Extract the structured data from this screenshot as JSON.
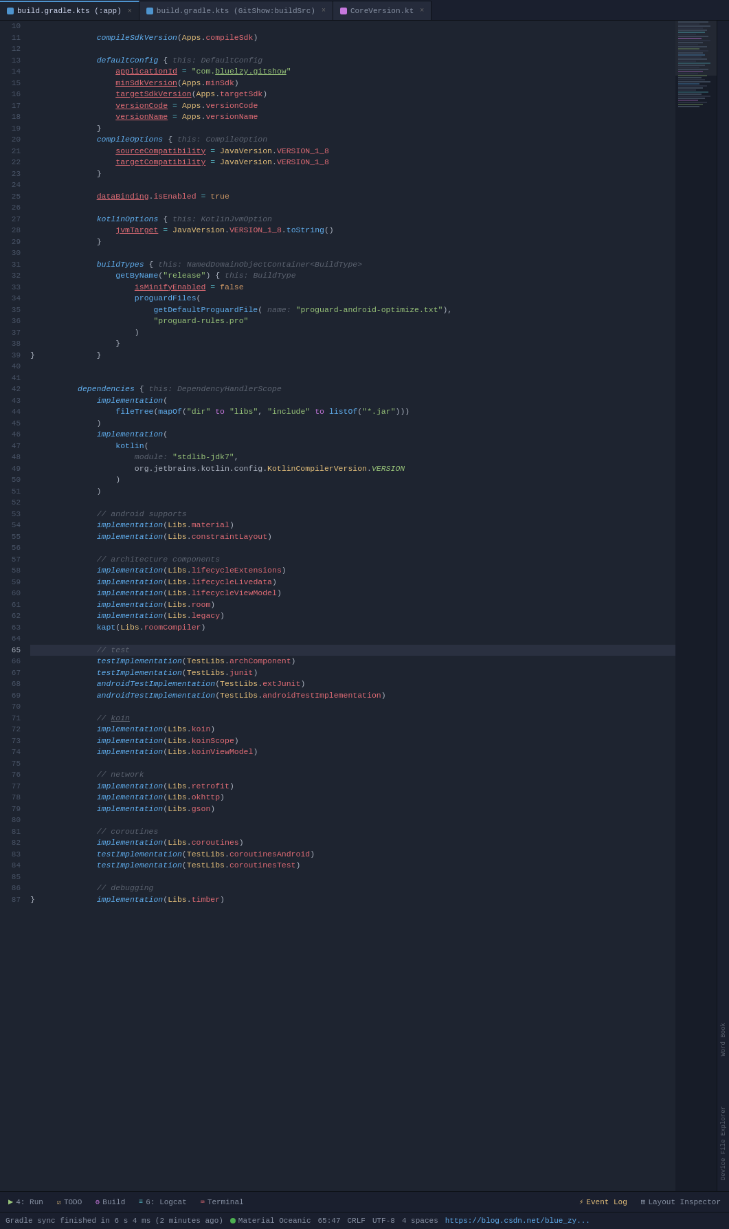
{
  "tabs": [
    {
      "id": "tab1",
      "label": "build.gradle.kts (:app)",
      "active": true,
      "icon": "gradle"
    },
    {
      "id": "tab2",
      "label": "build.gradle.kts (GitShow:buildSrc)",
      "active": false,
      "icon": "gradle"
    },
    {
      "id": "tab3",
      "label": "CoreVersion.kt",
      "active": false,
      "icon": "kotlin"
    }
  ],
  "editor": {
    "language": "Kotlin",
    "encoding": "UTF-8",
    "line": 65,
    "column": 47,
    "line_ending": "CRLF",
    "indent": "4 spaces"
  },
  "code_lines": [
    {
      "num": 10,
      "text": "    compileSdkVersion(Apps.compileSdk)"
    },
    {
      "num": 11,
      "text": ""
    },
    {
      "num": 12,
      "text": "    defaultConfig { this: DefaultConfig"
    },
    {
      "num": 13,
      "text": "        applicationId = \"com.bluelzy.gitshow\""
    },
    {
      "num": 14,
      "text": "        minSdkVersion(Apps.minSdk)"
    },
    {
      "num": 15,
      "text": "        targetSdkVersion(Apps.targetSdk)"
    },
    {
      "num": 16,
      "text": "        versionCode = Apps.versionCode"
    },
    {
      "num": 17,
      "text": "        versionName = Apps.versionName"
    },
    {
      "num": 18,
      "text": "    }"
    },
    {
      "num": 19,
      "text": "    compileOptions { this: CompileOption"
    },
    {
      "num": 20,
      "text": "        sourceCompatibility = JavaVersion.VERSION_1_8"
    },
    {
      "num": 21,
      "text": "        targetCompatibility = JavaVersion.VERSION_1_8"
    },
    {
      "num": 22,
      "text": "    }"
    },
    {
      "num": 23,
      "text": ""
    },
    {
      "num": 24,
      "text": "    dataBinding.isEnabled = true"
    },
    {
      "num": 25,
      "text": ""
    },
    {
      "num": 26,
      "text": "    kotlinOptions { this: KotlinJvmOption"
    },
    {
      "num": 27,
      "text": "        jvmTarget = JavaVersion.VERSION_1_8.toString()"
    },
    {
      "num": 28,
      "text": "    }"
    },
    {
      "num": 29,
      "text": ""
    },
    {
      "num": 30,
      "text": "    buildTypes { this: NamedDomainObjectContainer<BuildType>"
    },
    {
      "num": 31,
      "text": "        getByName(\"release\") { this: BuildType"
    },
    {
      "num": 32,
      "text": "            isMinifyEnabled = false"
    },
    {
      "num": 33,
      "text": "            proguardFiles("
    },
    {
      "num": 34,
      "text": "                getDefaultProguardFile( name: \"proguard-android-optimize.txt\"),"
    },
    {
      "num": 35,
      "text": "                \"proguard-rules.pro\""
    },
    {
      "num": 36,
      "text": "            )"
    },
    {
      "num": 37,
      "text": "        }"
    },
    {
      "num": 38,
      "text": "    }"
    },
    {
      "num": 39,
      "text": "}"
    },
    {
      "num": 40,
      "text": ""
    },
    {
      "num": 41,
      "text": "dependencies { this: DependencyHandlerScope"
    },
    {
      "num": 42,
      "text": "    implementation("
    },
    {
      "num": 43,
      "text": "        fileTree(mapOf(\"dir\" to \"libs\", \"include\" to listOf(\"*.jar\")))"
    },
    {
      "num": 44,
      "text": "    )"
    },
    {
      "num": 45,
      "text": "    implementation("
    },
    {
      "num": 46,
      "text": "        kotlin("
    },
    {
      "num": 47,
      "text": "            module: \"stdlib-jdk7\","
    },
    {
      "num": 48,
      "text": "            org.jetbrains.kotlin.config.KotlinCompilerVersion.VERSION"
    },
    {
      "num": 49,
      "text": "        )"
    },
    {
      "num": 50,
      "text": "    )"
    },
    {
      "num": 51,
      "text": ""
    },
    {
      "num": 52,
      "text": "    // android supports"
    },
    {
      "num": 53,
      "text": "    implementation(Libs.material)"
    },
    {
      "num": 54,
      "text": "    implementation(Libs.constraintLayout)"
    },
    {
      "num": 55,
      "text": ""
    },
    {
      "num": 56,
      "text": "    // architecture components"
    },
    {
      "num": 57,
      "text": "    implementation(Libs.lifecycleExtensions)"
    },
    {
      "num": 58,
      "text": "    implementation(Libs.lifecycleLivedata)"
    },
    {
      "num": 59,
      "text": "    implementation(Libs.lifecycleViewModel)"
    },
    {
      "num": 60,
      "text": "    implementation(Libs.room)"
    },
    {
      "num": 61,
      "text": "    implementation(Libs.legacy)"
    },
    {
      "num": 62,
      "text": "    kapt(Libs.roomCompiler)"
    },
    {
      "num": 63,
      "text": ""
    },
    {
      "num": 64,
      "text": "    // test"
    },
    {
      "num": 65,
      "text": "    testImplementation(TestLibs.archComponent)"
    },
    {
      "num": 66,
      "text": "    testImplementation(TestLibs.junit)"
    },
    {
      "num": 67,
      "text": "    androidTestImplementation(TestLibs.extJunit)"
    },
    {
      "num": 68,
      "text": "    androidTestImplementation(TestLibs.androidTestImplementation)"
    },
    {
      "num": 69,
      "text": ""
    },
    {
      "num": 70,
      "text": "    // koin"
    },
    {
      "num": 71,
      "text": "    implementation(Libs.koin)"
    },
    {
      "num": 72,
      "text": "    implementation(Libs.koinScope)"
    },
    {
      "num": 73,
      "text": "    implementation(Libs.koinViewModel)"
    },
    {
      "num": 74,
      "text": ""
    },
    {
      "num": 75,
      "text": "    // network"
    },
    {
      "num": 76,
      "text": "    implementation(Libs.retrofit)"
    },
    {
      "num": 77,
      "text": "    implementation(Libs.okhttp)"
    },
    {
      "num": 78,
      "text": "    implementation(Libs.gson)"
    },
    {
      "num": 79,
      "text": ""
    },
    {
      "num": 80,
      "text": "    // coroutines"
    },
    {
      "num": 81,
      "text": "    implementation(Libs.coroutines)"
    },
    {
      "num": 82,
      "text": "    testImplementation(TestLibs.coroutinesAndroid)"
    },
    {
      "num": 83,
      "text": "    testImplementation(TestLibs.coroutinesTest)"
    },
    {
      "num": 84,
      "text": ""
    },
    {
      "num": 85,
      "text": "    // debugging"
    },
    {
      "num": 86,
      "text": "    implementation(Libs.timber)"
    },
    {
      "num": 87,
      "text": "}"
    }
  ],
  "bottom_toolbar": {
    "run_label": "4: Run",
    "todo_label": "TODO",
    "build_label": "Build",
    "logcat_label": "6: Logcat",
    "terminal_label": "Terminal",
    "event_log_label": "Event Log",
    "layout_inspector_label": "Layout Inspector"
  },
  "status_bar": {
    "sync_message": "Gradle sync finished in 6 s 4 ms (2 minutes ago)",
    "theme": "Material Oceanic",
    "position": "65:47",
    "line_ending": "CRLF",
    "encoding": "UTF-8",
    "indent": "4 spaces",
    "url": "https://blog.csdn.net/blue_zy..."
  },
  "right_toolbar": {
    "items": [
      "Word Book",
      "Device File Explorer"
    ]
  }
}
